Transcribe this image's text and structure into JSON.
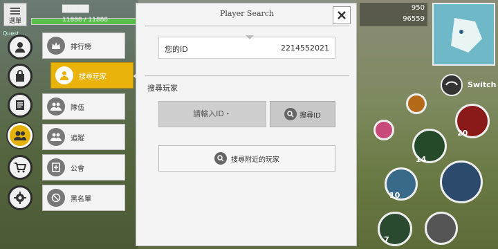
{
  "hud": {
    "menu_label": "選單",
    "player_name": "█████",
    "hp_text": "11888 / 11888",
    "quest_text": "Quest ...",
    "gauge_top": "950",
    "gauge_bottom": "96559",
    "switch_label": "Switch",
    "skill_numbers": [
      "20",
      "14",
      "10",
      "7"
    ]
  },
  "side_menu": {
    "items": [
      {
        "label": "排行榜"
      },
      {
        "label": "搜尋玩家"
      },
      {
        "label": "隊伍"
      },
      {
        "label": "追蹤"
      },
      {
        "label": "公會"
      },
      {
        "label": "黑名單"
      }
    ]
  },
  "dialog": {
    "title": "Player Search",
    "my_id_label": "您的ID",
    "my_id_value": "2214552021",
    "search_section_label": "搜尋玩家",
    "id_input_placeholder": "請輸入ID・",
    "search_id_label": "搜尋ID",
    "nearby_label": "搜尋附近的玩家"
  },
  "colors": {
    "accent": "#e9b30c",
    "dialog_bg": "#f4f4f4"
  }
}
